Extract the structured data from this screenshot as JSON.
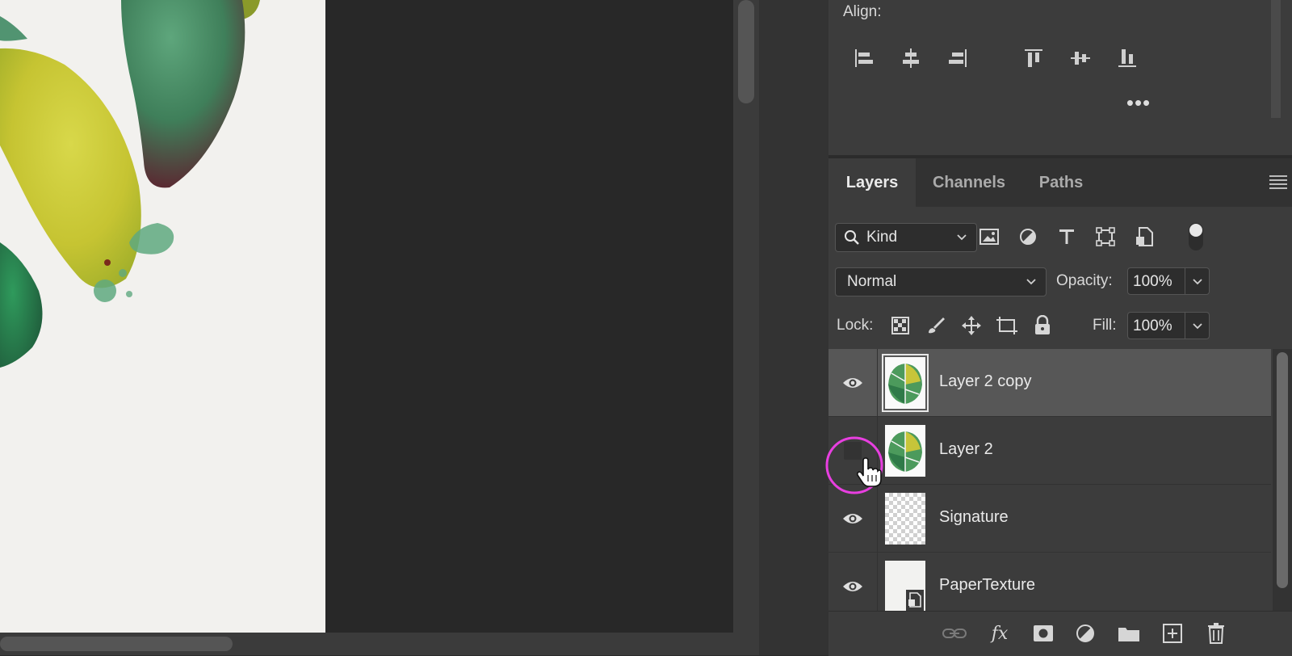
{
  "properties": {
    "align_label": "Align:",
    "align_buttons": [
      {
        "icon": "align-left-edges-icon"
      },
      {
        "icon": "align-horizontal-centers-icon"
      },
      {
        "icon": "align-right-edges-icon"
      },
      {
        "icon": "align-top-edges-icon"
      },
      {
        "icon": "align-vertical-centers-icon"
      },
      {
        "icon": "align-bottom-edges-icon"
      }
    ],
    "more_label": "•••"
  },
  "layers_panel": {
    "tabs": [
      {
        "label": "Layers",
        "active": true
      },
      {
        "label": "Channels",
        "active": false
      },
      {
        "label": "Paths",
        "active": false
      }
    ],
    "filter": {
      "kind_label": "Kind",
      "icons": [
        "image-filter-icon",
        "adjustment-filter-icon",
        "type-filter-icon",
        "shape-filter-icon",
        "smart-object-filter-icon"
      ]
    },
    "blend_mode": "Normal",
    "opacity_label": "Opacity:",
    "opacity_value": "100%",
    "lock_label": "Lock:",
    "lock_icons": [
      "lock-transparent-pixels-icon",
      "lock-image-pixels-icon",
      "lock-position-icon",
      "lock-artboard-icon",
      "lock-all-icon"
    ],
    "fill_label": "Fill:",
    "fill_value": "100%",
    "layers": [
      {
        "name": "Layer 2 copy",
        "visible": true,
        "selected": true,
        "thumb": "leaf"
      },
      {
        "name": "Layer 2",
        "visible": false,
        "selected": false,
        "thumb": "leaf"
      },
      {
        "name": "Signature",
        "visible": true,
        "selected": false,
        "thumb": "transparent"
      },
      {
        "name": "PaperTexture",
        "visible": true,
        "selected": false,
        "thumb": "smart-object"
      }
    ],
    "footer_icons": [
      "link-layers-icon",
      "fx-icon",
      "add-mask-icon",
      "new-adjustment-icon",
      "new-group-icon",
      "new-layer-icon",
      "delete-layer-icon"
    ]
  },
  "colors": {
    "highlight_ring": "#e83fe0",
    "selected_row": "#575757",
    "panel_bg": "#3c3c3c"
  }
}
